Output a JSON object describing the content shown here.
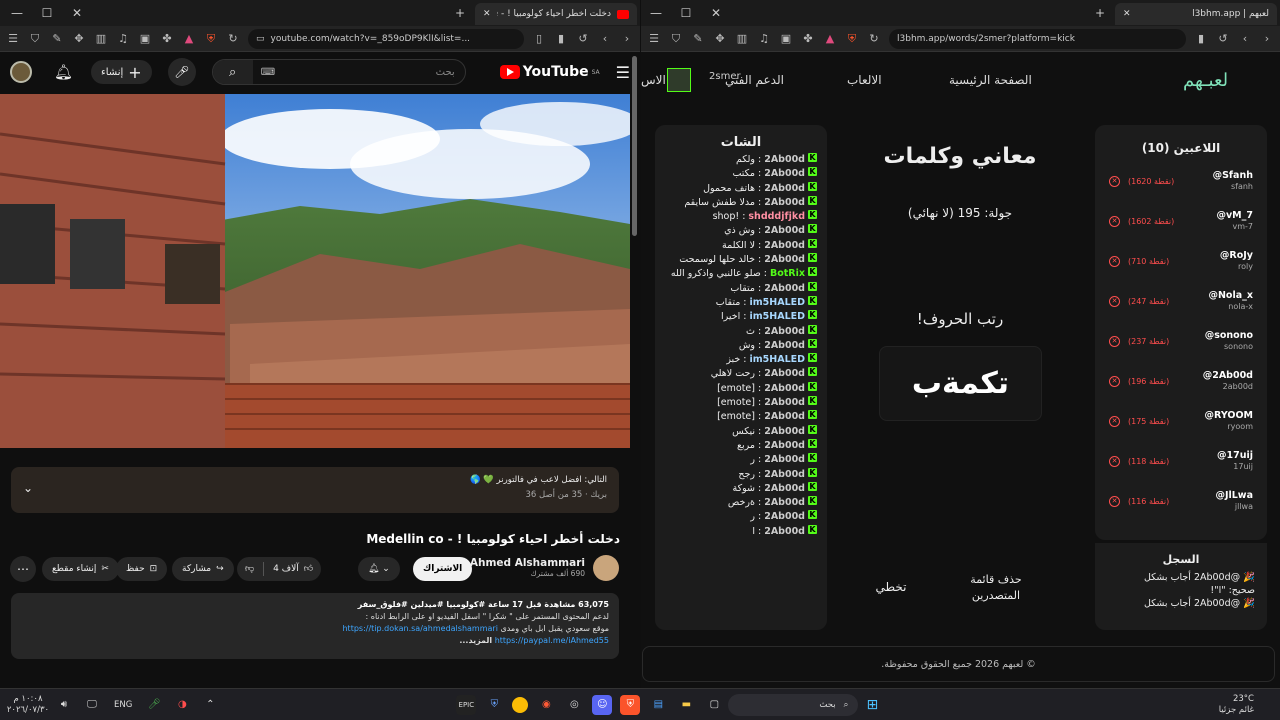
{
  "left": {
    "tab_title": "دخلت أخطر احياء كولومبيا ! - Me",
    "url": "youtube.com/watch?v=_859oDP9KlI&list=...",
    "yt": {
      "logo_text": "YouTube",
      "region": "SA",
      "search_placeholder": "بحث",
      "create_label": "إنشاء"
    },
    "pinned_comment": {
      "text": "التالي: افضل لاعب في فالتورنر 💚 🌎",
      "sub": "بريك · 35 من أصل 36"
    },
    "video_title": "دخلت أخطر احياء كولومبيا ! - Medellin co",
    "channel": {
      "name": "Ahmed Alshammari",
      "subs": "690 ألف مشترك"
    },
    "subscribe_label": "الاشتراك",
    "actions": {
      "likes": "4 آلاف",
      "share": "مشاركة",
      "save": "حفظ",
      "clip": "إنشاء مقطع"
    },
    "description": {
      "stats": "63,075 مشاهدة قبل 17 ساعة #كولومبيا #ميدلين #فلوق_سفر",
      "line1": "لدعم المحتوى المستمر على \" شكرا \" اسفل الفيديو او على الرابط ادناه :",
      "line2": "موقع سعودي يقبل ابل باي ومدى",
      "link1": "https://tip.dokan.sa/ahmedalshammari",
      "link2": "https://paypal.me/iAhmed55",
      "more": "المزيد..."
    }
  },
  "right": {
    "tab_title": "لعبهم | l3bhm.app",
    "url": "l3bhm.app/words/2smer?platform=kick",
    "nav": {
      "logo": "لعبـهم",
      "home": "الصفحة الرئيسية",
      "games": "الالعاب",
      "support": "الدعم الفني",
      "user": "2smer",
      "extra": "الاس"
    },
    "chat": {
      "title": "الشات",
      "messages": [
        {
          "user": "2Ab00d",
          "text": "ولكم",
          "color": "#cccccc"
        },
        {
          "user": "2Ab00d",
          "text": "مكتب",
          "color": "#cccccc"
        },
        {
          "user": "2Ab00d",
          "text": "هاتف محمول",
          "color": "#cccccc"
        },
        {
          "user": "2Ab00d",
          "text": "مدلا طفش سايقم",
          "color": "#cccccc"
        },
        {
          "user": "shdddjfjkd",
          "text": "!shop",
          "color": "#ff8fa3"
        },
        {
          "user": "2Ab00d",
          "text": "وش ذي",
          "color": "#cccccc"
        },
        {
          "user": "2Ab00d",
          "text": "لا الكلمة",
          "color": "#cccccc"
        },
        {
          "user": "2Ab00d",
          "text": "خالد حلها لوسمحت",
          "color": "#cccccc"
        },
        {
          "user": "BotRix",
          "text": "صلو عالنبي واذكرو الله",
          "color": "#53fc18"
        },
        {
          "user": "2Ab00d",
          "text": "متقاب",
          "color": "#cccccc"
        },
        {
          "user": "im5HALED",
          "text": "متقاب",
          "color": "#a8d8ff"
        },
        {
          "user": "im5HALED",
          "text": "اخيرا",
          "color": "#a8d8ff"
        },
        {
          "user": "2Ab00d",
          "text": "ث",
          "color": "#cccccc"
        },
        {
          "user": "2Ab00d",
          "text": "وش",
          "color": "#cccccc"
        },
        {
          "user": "im5HALED",
          "text": "خبز",
          "color": "#a8d8ff"
        },
        {
          "user": "2Ab00d",
          "text": "رحت لاهلي",
          "color": "#cccccc"
        },
        {
          "user": "2Ab00d",
          "text": "[emote]",
          "color": "#cccccc"
        },
        {
          "user": "2Ab00d",
          "text": "[emote]",
          "color": "#cccccc"
        },
        {
          "user": "2Ab00d",
          "text": "[emote]",
          "color": "#cccccc"
        },
        {
          "user": "2Ab00d",
          "text": "نيكس",
          "color": "#cccccc"
        },
        {
          "user": "2Ab00d",
          "text": "مربع",
          "color": "#cccccc"
        },
        {
          "user": "2Ab00d",
          "text": "ر",
          "color": "#cccccc"
        },
        {
          "user": "2Ab00d",
          "text": "رجح",
          "color": "#cccccc"
        },
        {
          "user": "2Ab00d",
          "text": "شوكة",
          "color": "#cccccc"
        },
        {
          "user": "2Ab00d",
          "text": "ةرخص",
          "color": "#cccccc"
        },
        {
          "user": "2Ab00d",
          "text": "ر",
          "color": "#cccccc"
        },
        {
          "user": "2Ab00d",
          "text": "ا",
          "color": "#cccccc"
        }
      ]
    },
    "game": {
      "title": "معاني وكلمات",
      "round": "جولة: 195 (لا نهائي)",
      "prompt": "رتب الحروف!",
      "letters": "تكمةب",
      "clear_leaderboard": "حذف قائمة المتصدرين",
      "skip": "تخطي"
    },
    "players": {
      "title": "اللاعبين (10)",
      "list": [
        {
          "name": "@Sfanh",
          "handle": "sfanh",
          "points": "(1620 نقطة)"
        },
        {
          "name": "@vM_7",
          "handle": "vm-7",
          "points": "(1602 نقطة)"
        },
        {
          "name": "@RoJy",
          "handle": "roly",
          "points": "(710 نقطة)"
        },
        {
          "name": "@Nola_x",
          "handle": "nola-x",
          "points": "(247 نقطة)"
        },
        {
          "name": "@sonono",
          "handle": "sonono",
          "points": "(237 نقطة)"
        },
        {
          "name": "@2Ab00d",
          "handle": "2ab00d",
          "points": "(196 نقطة)"
        },
        {
          "name": "@RYOOM",
          "handle": "ryoom",
          "points": "(175 نقطة)"
        },
        {
          "name": "@17uij",
          "handle": "17uij",
          "points": "(118 نقطة)"
        },
        {
          "name": "@JlLwa",
          "handle": "jllwa",
          "points": "(116 نقطة)"
        }
      ]
    },
    "log": {
      "title": "السجل",
      "lines": [
        "🎉 @2Ab00d أجاب بشكل",
        "صحيح: \"ا\"!",
        "🎉 @2Ab00d أجاب بشكل"
      ]
    },
    "footer": "© لعبهم 2026 جميع الحقوق محفوظة."
  },
  "taskbar": {
    "weather": "23°C",
    "weather_sub": "غائم جزئيا",
    "search": "بحث",
    "lang": "ENG",
    "time": "١٠:٠٨ م",
    "date": "٢٠٢٦/٠٧/٣٠"
  }
}
